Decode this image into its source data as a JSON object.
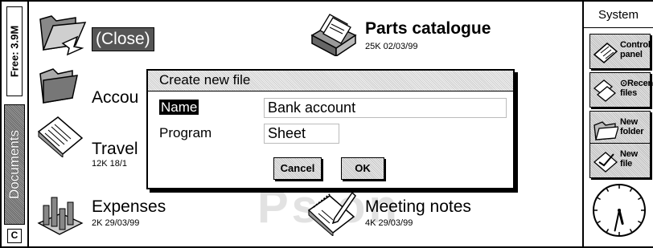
{
  "left_bar": {
    "free_label": "Free: 3.9M",
    "documents_tab": "Documents",
    "c_key": "C"
  },
  "right_bar": {
    "header": "System",
    "buttons": [
      {
        "line1": "Control",
        "line2": "panel",
        "icon": "control-panel-icon"
      },
      {
        "line1": "⊙Recent",
        "line2": "files",
        "icon": "recent-files-icon"
      },
      {
        "line1": "New",
        "line2": "folder",
        "icon": "new-folder-icon"
      },
      {
        "line1": "New",
        "line2": "file",
        "icon": "new-file-icon"
      }
    ],
    "clock": {
      "hour": 5,
      "minute": 32
    }
  },
  "desktop": {
    "items": [
      {
        "name": "(Close)",
        "meta": "",
        "icon": "open-folder-icon"
      },
      {
        "name": "Parts catalogue",
        "meta": "25K 02/03/99",
        "icon": "card-file-icon"
      },
      {
        "name": "Accou",
        "meta": "",
        "icon": "folder-icon"
      },
      {
        "name": "Travel",
        "meta": "12K 18/1",
        "icon": "document-icon"
      },
      {
        "name": "Expenses",
        "meta": "2K 29/03/99",
        "icon": "spreadsheet-icon"
      },
      {
        "name": "Meeting notes",
        "meta": "4K 29/03/99",
        "icon": "notepad-icon"
      }
    ],
    "watermark": "Psion"
  },
  "dialog": {
    "title": "Create new file",
    "name_label": "Name",
    "name_value": "Bank account",
    "program_label": "Program",
    "program_value": "Sheet",
    "cancel_label": "Cancel",
    "ok_label": "OK"
  }
}
